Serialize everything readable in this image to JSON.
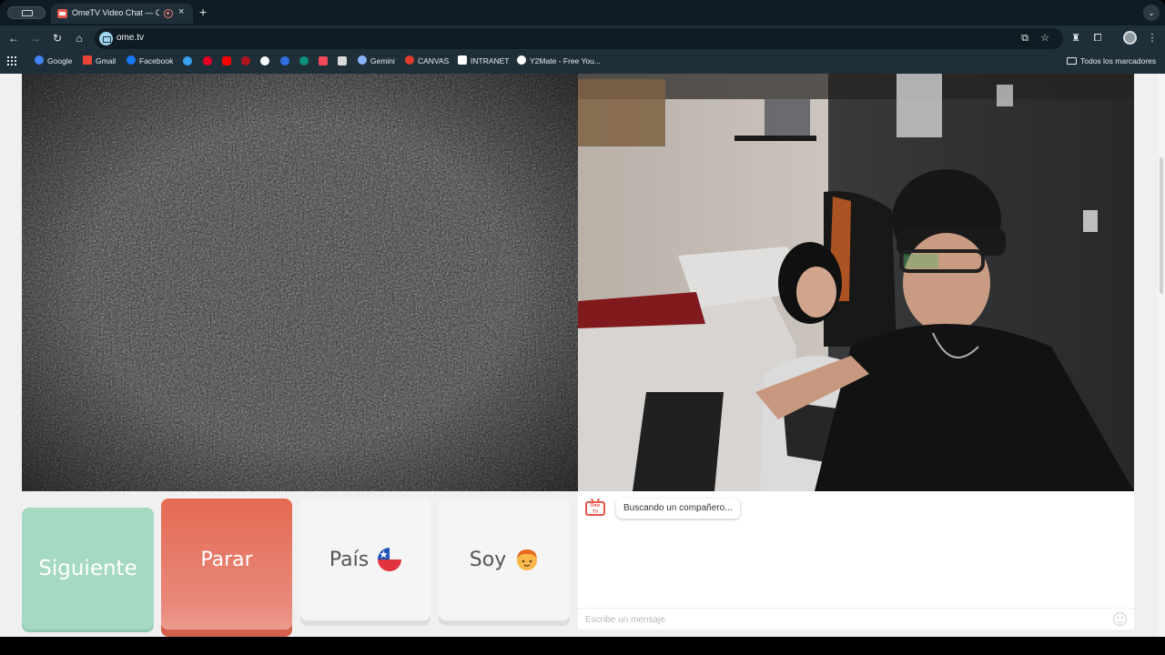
{
  "browser": {
    "tab_title": "OmeTV Video Chat — Ome",
    "tab_close": "×",
    "new_tab": "+",
    "url": "ome.tv",
    "tab_menu": "⌄"
  },
  "bookmarks": {
    "items": [
      {
        "label": "Google",
        "color": "#4285f4"
      },
      {
        "label": "Gmail",
        "color": "#ea4335"
      },
      {
        "label": "Facebook",
        "color": "#1877f2"
      },
      {
        "label": "Gemini",
        "color": "#8ab4f8"
      },
      {
        "label": "CANVAS",
        "color": "#e33b2e"
      },
      {
        "label": "INTRANET",
        "color": "#ffffff"
      },
      {
        "label": "Y2Mate - Free You...",
        "color": "#ffffff"
      }
    ],
    "all_bookmarks": "Todos los marcadores"
  },
  "controls": {
    "next": "Siguiente",
    "stop": "Parar",
    "country": "País",
    "country_flag": "🇨🇱",
    "gender": "Soy",
    "gender_emoji": "🧑"
  },
  "chat": {
    "logo_line1": "Ome",
    "logo_line2": "TV",
    "status_message": "Buscando un compañero...",
    "input_placeholder": "Escribe un mensaje"
  },
  "colors": {
    "next_button": "#a6d9c2",
    "stop_button": "#e56a53",
    "brand_red": "#e7574a"
  }
}
